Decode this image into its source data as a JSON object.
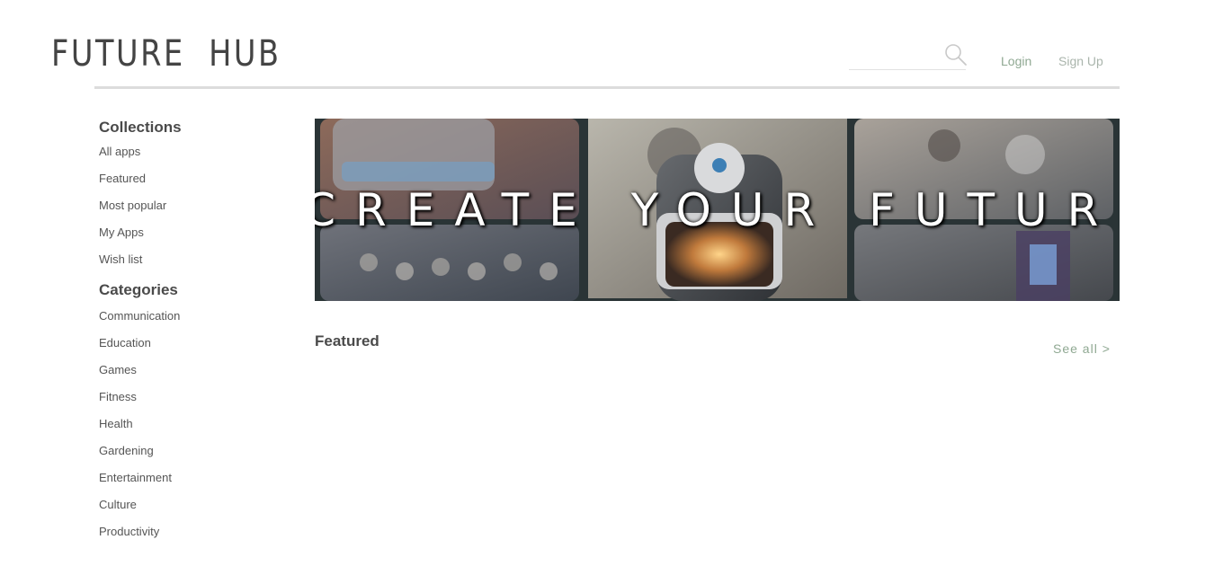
{
  "header": {
    "logo": "FUTURE  HUB",
    "search": {
      "value": "",
      "placeholder": ""
    },
    "nav": {
      "login": "Login",
      "signup": "Sign Up"
    }
  },
  "sidebar": {
    "collections_heading": "Collections",
    "collections": [
      "All apps",
      "Featured",
      "Most popular",
      "My Apps",
      "Wish list"
    ],
    "categories_heading": "Categories",
    "categories": [
      "Communication",
      "Education",
      "Games",
      "Fitness",
      "Health",
      "Gardening",
      "Entertainment",
      "Culture",
      "Productivity"
    ]
  },
  "banner": {
    "text": "CREATE YOUR FUTURE"
  },
  "featured": {
    "title": "Featured",
    "see_all": "See all >"
  },
  "colors": {
    "accent_green": "#8fa892",
    "muted_green": "#aab5ac",
    "text_dark": "#4a4a4a",
    "rule": "#dcdcdc"
  },
  "icons": {
    "search": "search-icon"
  }
}
